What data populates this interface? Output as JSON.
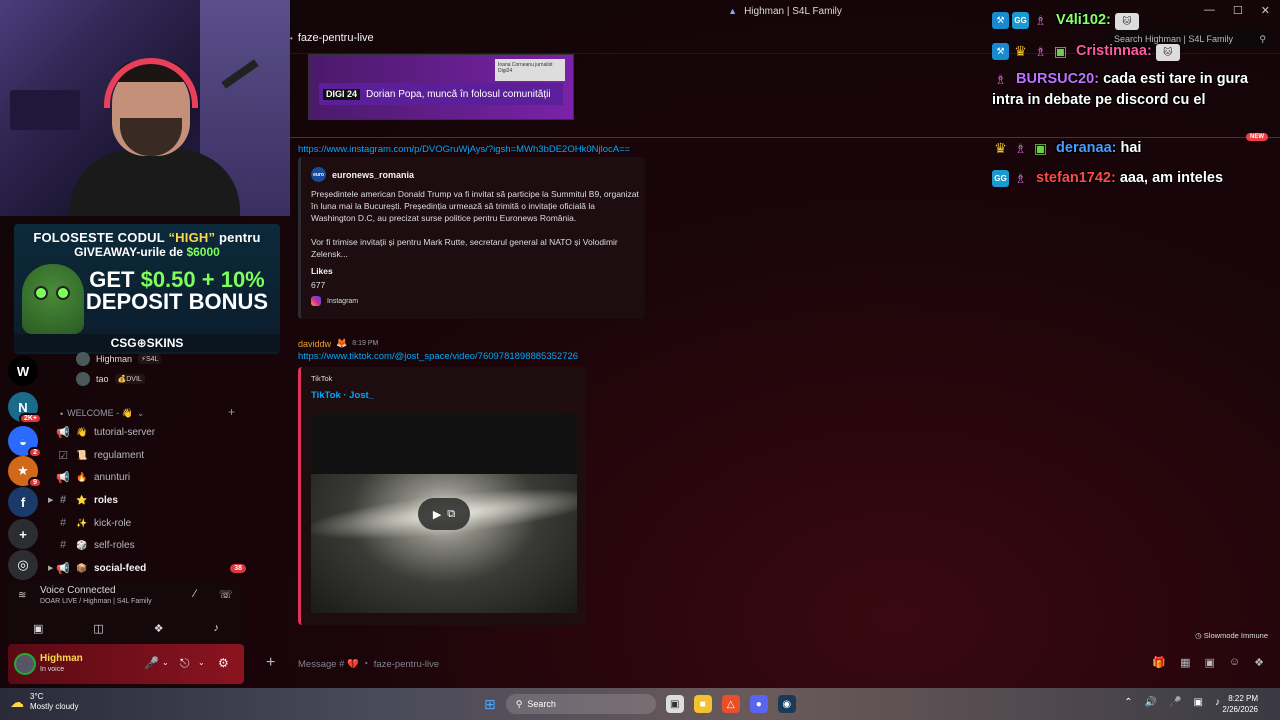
{
  "window": {
    "title": "Highman | S4L Family",
    "controls": [
      "—",
      "☐",
      "✕"
    ]
  },
  "search": {
    "placeholder": "Search Highman | S4L Family"
  },
  "channel_header": {
    "name": "faze-pentru-live"
  },
  "ad": {
    "line1_prefix": "FOLOSESTE CODUL ",
    "line1_code": "“HIGH”",
    "line1_suffix": " pentru",
    "line2_prefix": "GIVEAWAY-urile de ",
    "line2_amount": "$6000",
    "big1_prefix": "GET ",
    "big1_amount": "$0.50 + 10%",
    "big2": "DEPOSIT BONUS",
    "brand": "CSG⊕SKINS"
  },
  "server_rail": [
    {
      "label": "W",
      "badge": ""
    },
    {
      "label": "N",
      "badge": "2K+"
    },
    {
      "label": "◒",
      "badge": "2"
    },
    {
      "label": "★",
      "badge": "9"
    },
    {
      "label": "f",
      "badge": ""
    },
    {
      "label": "+",
      "badge": ""
    },
    {
      "label": "◎",
      "badge": ""
    }
  ],
  "voice_users": [
    {
      "name": "Highman",
      "tag": "⚡S4L"
    },
    {
      "name": "tao",
      "tag": "💰DVIL"
    }
  ],
  "category": {
    "label": "WELCOME - 👋"
  },
  "channels": [
    {
      "icon": "📢",
      "emoji": "👋",
      "name": "tutorial-server",
      "bold": false,
      "badge": ""
    },
    {
      "icon": "☑",
      "emoji": "📜",
      "name": "regulament",
      "bold": false,
      "badge": ""
    },
    {
      "icon": "📢",
      "emoji": "🔥",
      "name": "anunturi",
      "bold": false,
      "badge": ""
    },
    {
      "icon": "#",
      "emoji": "⭐",
      "name": "roles",
      "bold": true,
      "badge": ""
    },
    {
      "icon": "#",
      "emoji": "✨",
      "name": "kick-role",
      "bold": false,
      "badge": ""
    },
    {
      "icon": "#",
      "emoji": "🎲",
      "name": "self-roles",
      "bold": false,
      "badge": ""
    },
    {
      "icon": "📢",
      "emoji": "📦",
      "name": "social-feed",
      "bold": true,
      "badge": "38"
    }
  ],
  "voice_panel": {
    "title": "Voice Connected",
    "subtitle": "DOAR LIVE / Highman | S4L Family"
  },
  "user_panel": {
    "name": "Highman",
    "status": "In voice"
  },
  "messages": {
    "news_embed": {
      "channel": "DIGI 24",
      "headline": "Dorian Popa, muncă în folosul comunității",
      "card": "Ioana Corneanu jurnalist Digi24"
    },
    "new_label": "NEW",
    "ig_link": "https://www.instagram.com/p/DVOGruWjAys/?igsh=MWh3bDE2OHk0NjlocA==",
    "ig_embed": {
      "author": "euronews_romania",
      "desc1": "Președintele american Donald Trump va fi invitat să participe la Summitul B9, organizat în luna mai la București. Președinția urmează să trimită o invitație oficială la Washington D.C, au precizat surse politice pentru Euronews România.",
      "desc2": "Vor fi trimise invitații și pentru Mark Rutte, secretarul general al NATO și Volodimir Zelensk...",
      "field_name": "Likes",
      "field_value": "677",
      "footer": "Instagram"
    },
    "tt_author": "daviddw",
    "tt_time": "8:19 PM",
    "tt_link": "https://www.tiktok.com/@jost_space/video/7609781898885352726",
    "tt_embed": {
      "provider": "TikTok",
      "title": "TikTok · Jost_"
    }
  },
  "slowmode": "Slowmode Immune",
  "composer": {
    "placeholder": "Message # 💔 ・ faze-pentru-live"
  },
  "chat_overlay": [
    {
      "badges": [
        "pick",
        "gg",
        "robot"
      ],
      "user": "V4li102:",
      "color": "#8aff6a",
      "text": ""
    },
    {
      "badges": [
        "pick",
        "crown",
        "robot",
        "gift"
      ],
      "user": "Cristinnaa:",
      "color": "#ff5aa0",
      "text": ""
    },
    {
      "badges": [
        "robot"
      ],
      "user": "BURSUC20:",
      "color": "#c070ff",
      "text": "cada esti tare in gura intra in debate pe discord cu el"
    },
    {
      "badges": [
        "crown",
        "robot",
        "gift"
      ],
      "user": "deranaa:",
      "color": "#4a9aff",
      "text": "hai"
    },
    {
      "badges": [
        "gg",
        "robot"
      ],
      "user": "stefan1742:",
      "color": "#ff4a4a",
      "text": "aaa, am inteles"
    }
  ],
  "taskbar": {
    "weather_temp": "3°C",
    "weather_desc": "Mostly cloudy",
    "search": "Search",
    "time": "8:22 PM",
    "date": "2/26/2026"
  }
}
